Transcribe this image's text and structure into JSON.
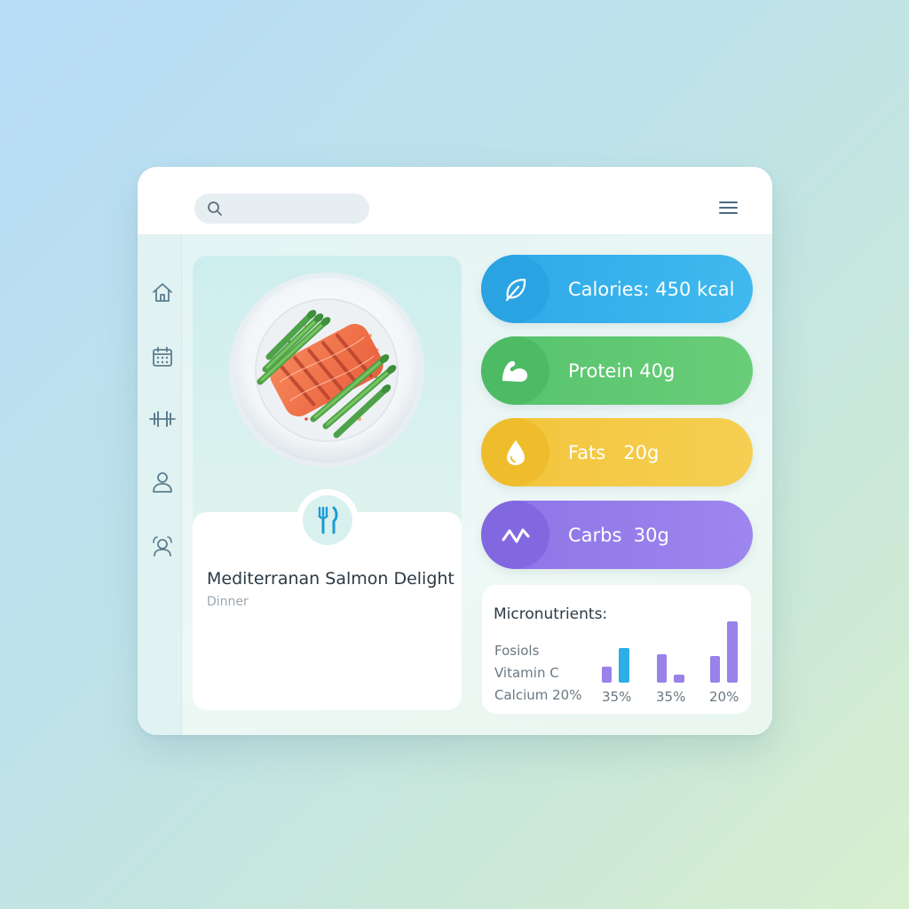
{
  "header": {
    "search_placeholder": ""
  },
  "sidebar": {
    "items": [
      {
        "name": "home"
      },
      {
        "name": "calendar"
      },
      {
        "name": "workouts"
      },
      {
        "name": "profile"
      },
      {
        "name": "community"
      }
    ]
  },
  "meal": {
    "title": "Mediterranan Salmon Delight",
    "category": "Dinner"
  },
  "macros": {
    "calories": "Calories: 450 kcal",
    "protein": "Protein 40g",
    "fats": "Fats   20g",
    "carbs": "Carbs  30g"
  },
  "micronutrients": {
    "title": "Micronutrients:",
    "rows": [
      "Fosiols",
      "Vitamin C",
      "Calcium 20%"
    ],
    "percent_labels": [
      "35%",
      "35%",
      "20%"
    ]
  },
  "colors": {
    "calories": "#2ea9e8",
    "protein": "#55c36d",
    "fats": "#f3c43b",
    "carbs": "#8c74e6",
    "bar_blue": "#2eaee6",
    "bar_purple": "#9a82ea"
  },
  "icons": {
    "calories": "leaf-icon",
    "protein": "muscle-icon",
    "fats": "drop-icon",
    "carbs": "wave-icon",
    "meal": "fork-knife-icon"
  }
}
